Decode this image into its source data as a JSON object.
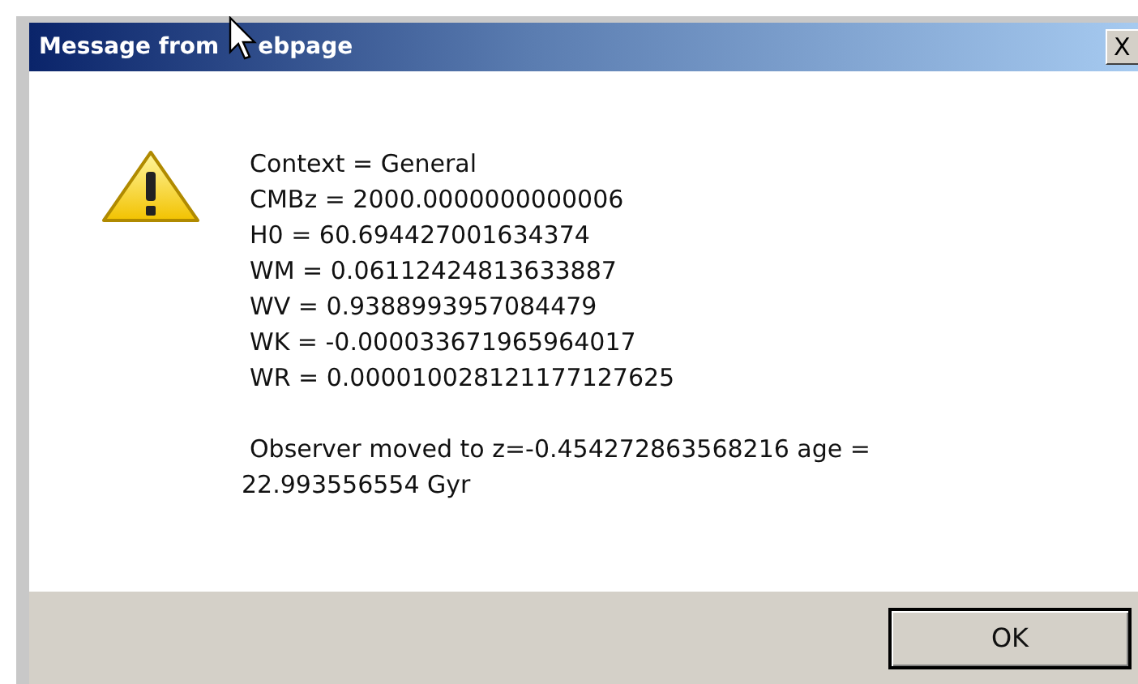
{
  "window": {
    "title_parts": [
      "Message from",
      "ebpage"
    ],
    "close": "X"
  },
  "message": {
    "lines": [
      "Context = General",
      "CMBz = 2000.0000000000006",
      "H0 = 60.694427001634374",
      "WM = 0.06112424813633887",
      "WV = 0.9388993957084479",
      "WK = -0.000033671965964017",
      "WR = 0.000010028121177127625"
    ],
    "note": "Observer moved to z=-0.454272863568216 age = 22.993556554 Gyr"
  },
  "buttons": [
    "OK"
  ]
}
